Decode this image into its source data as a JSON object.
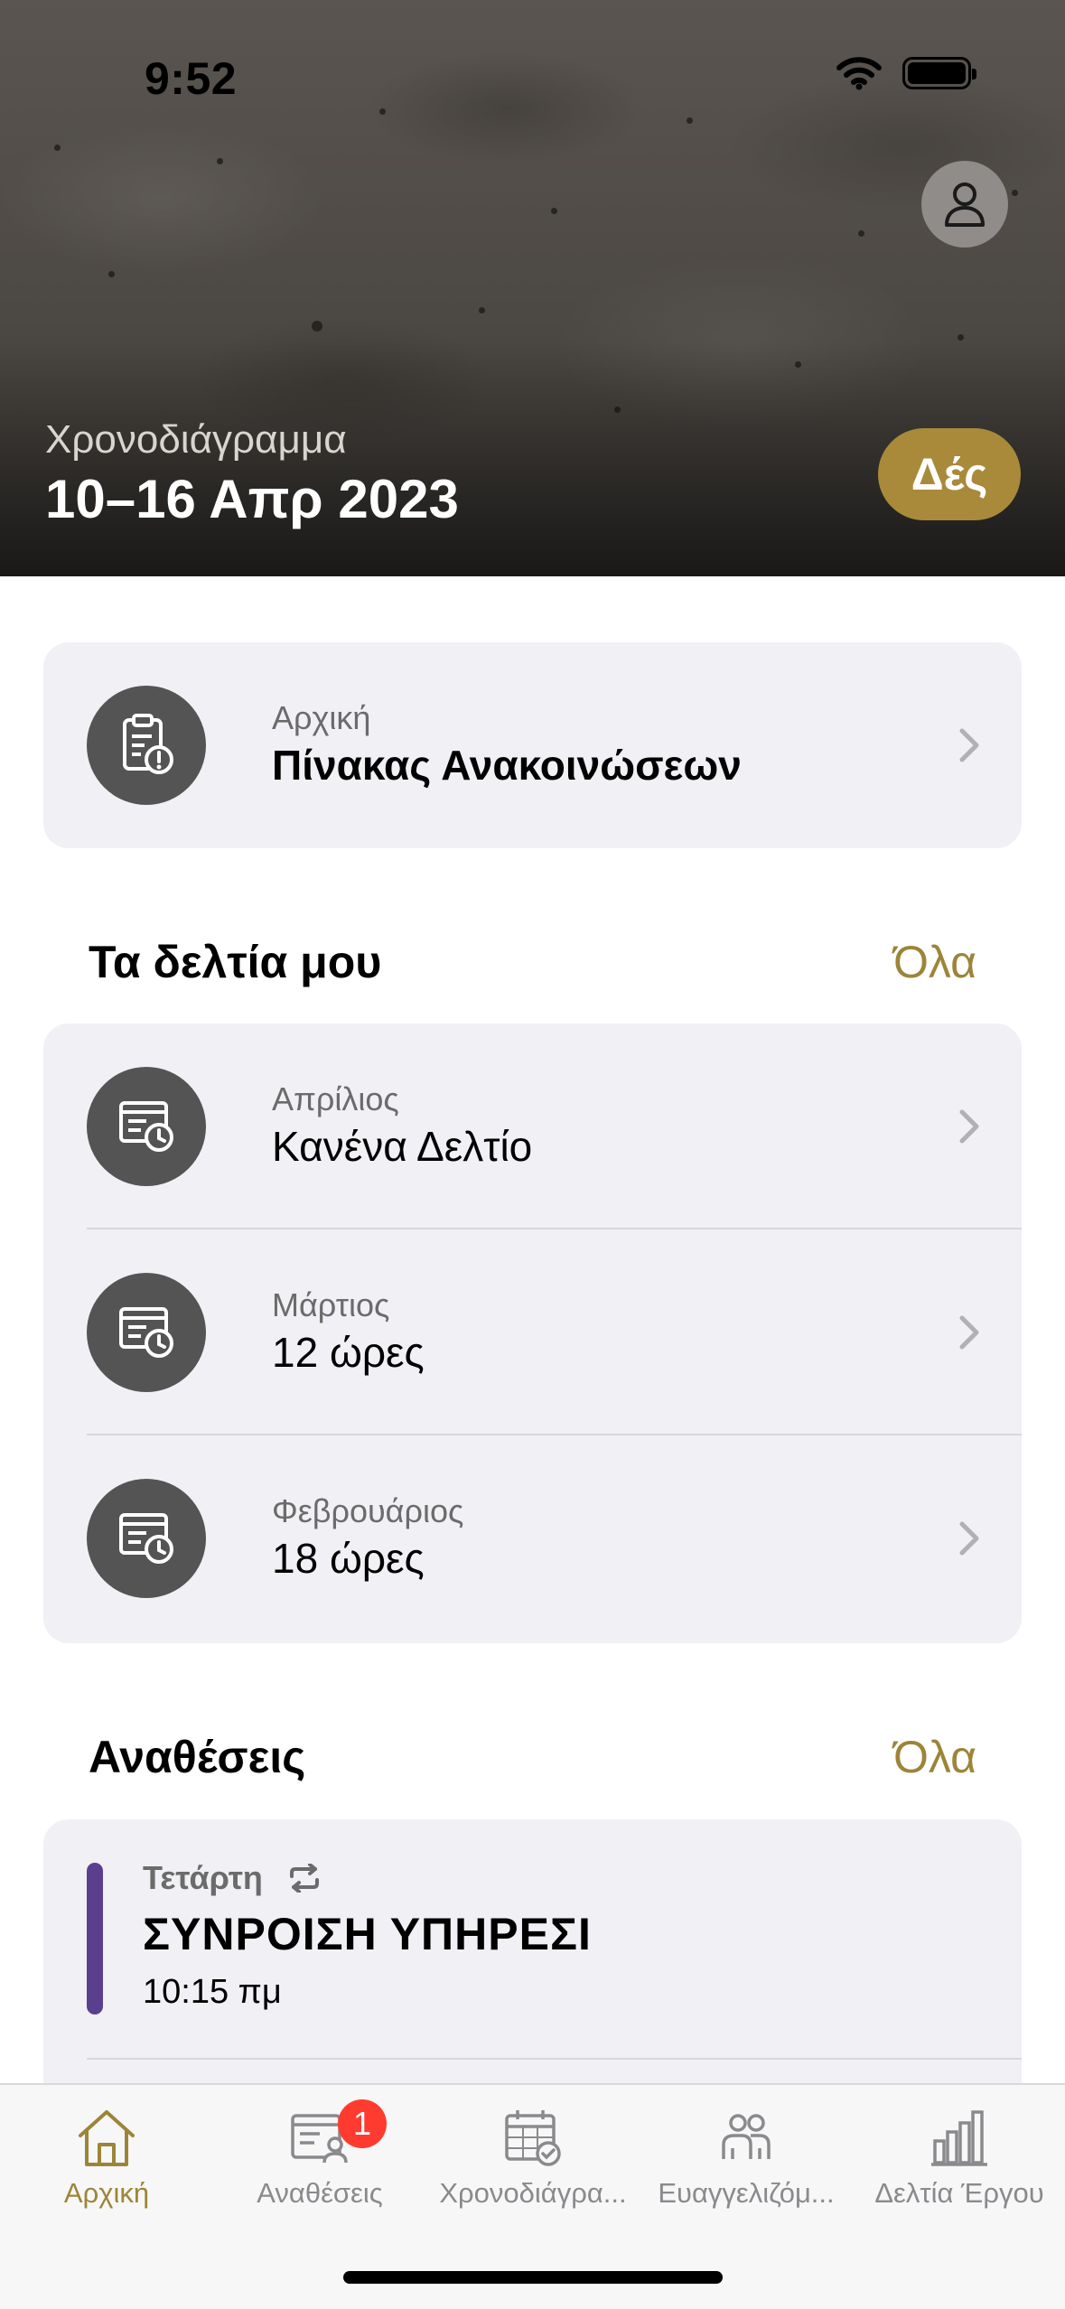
{
  "status_bar": {
    "time": "9:52"
  },
  "hero": {
    "subtitle": "Χρονοδιάγραμμα",
    "title": "10–16 Απρ 2023",
    "see_button": "Δές"
  },
  "notice_board": {
    "small": "Αρχική",
    "main": "Πίνακας Ανακοινώσεων"
  },
  "timesheets": {
    "title": "Τα δελτία μου",
    "all_link": "Όλα",
    "items": [
      {
        "month": "Απρίλιος",
        "value": "Κανένα Δελτίο"
      },
      {
        "month": "Μάρτιος",
        "value": "12 ώρες"
      },
      {
        "month": "Φεβρουάριος",
        "value": "18 ώρες"
      }
    ]
  },
  "assignments": {
    "title": "Αναθέσεις",
    "all_link": "Όλα",
    "items": [
      {
        "day": "Τετάρτη",
        "title": "ΣΥΝΡΟΙΣΗ ΥΠΗΡΕΣΙ",
        "time": "10:15 πμ"
      }
    ]
  },
  "tabbar": {
    "tabs": [
      {
        "label": "Αρχική",
        "icon": "home-icon",
        "active": true
      },
      {
        "label": "Αναθέσεις",
        "icon": "assignments-icon",
        "badge": "1"
      },
      {
        "label": "Χρονοδιάγρα...",
        "icon": "calendar-icon"
      },
      {
        "label": "Ευαγγελιζόμ...",
        "icon": "people-icon"
      },
      {
        "label": "Δελτία Έργου",
        "icon": "bar-chart-icon"
      }
    ]
  },
  "colors": {
    "accent": "#9c8539",
    "see_button": "#a88a3a",
    "assignment_bar": "#5b3f8f",
    "badge": "#ff3b30"
  }
}
